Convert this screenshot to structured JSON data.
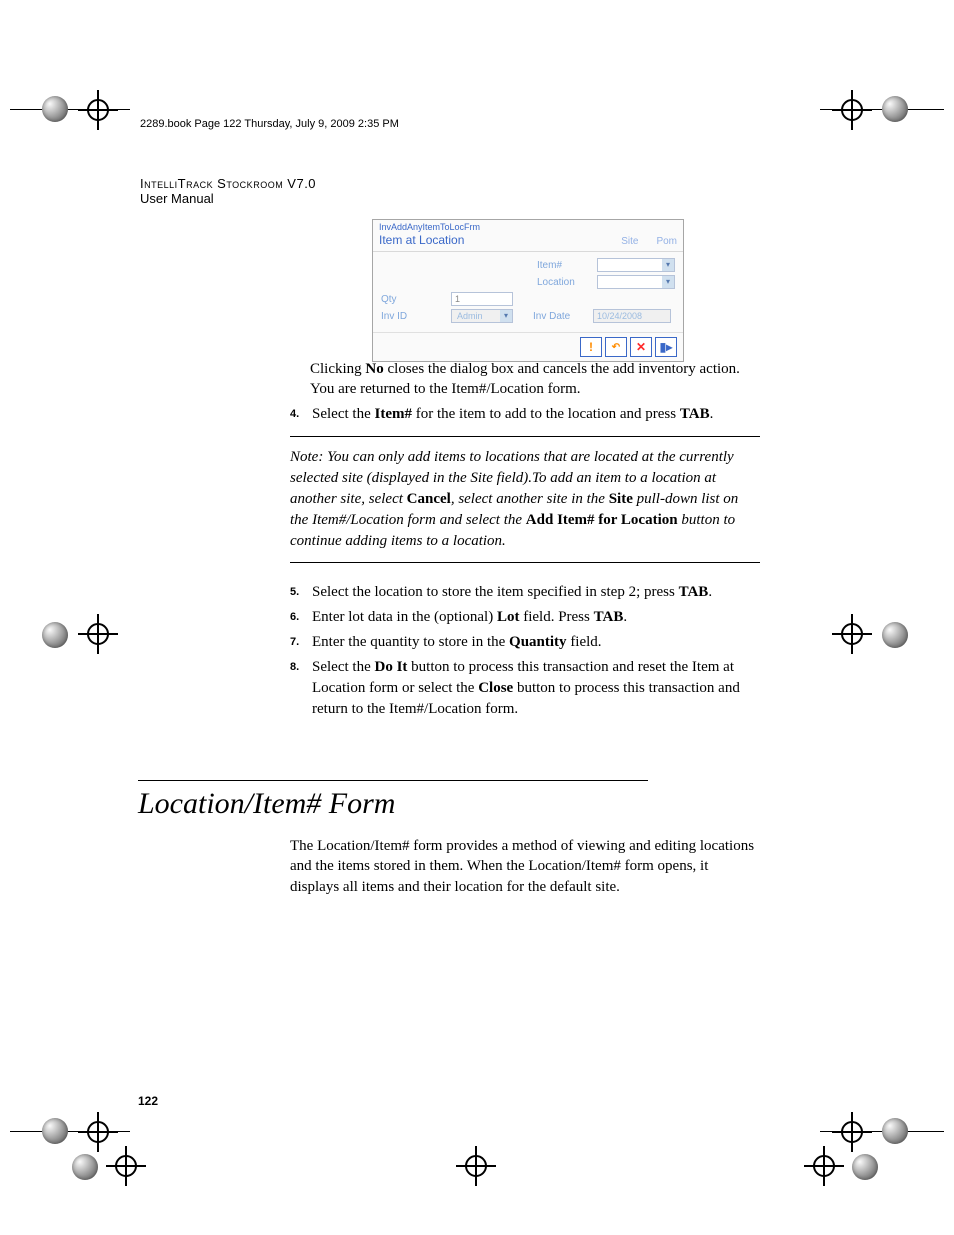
{
  "header_line": "2289.book  Page 122  Thursday, July 9, 2009  2:35 PM",
  "doc_title": "IntelliTrack Stockroom V7.0",
  "doc_subtitle": "User Manual",
  "figure": {
    "form_id": "InvAddAnyItemToLocFrm",
    "title": "Item at Location",
    "top_right_labels": {
      "site": "Site",
      "other": "Pom"
    },
    "labels": {
      "item": "Item#",
      "location": "Location",
      "qty": "Qty",
      "inv_id": "Inv ID",
      "inv_date": "Inv Date"
    },
    "values": {
      "qty": "1",
      "inv_id": "Admin",
      "inv_date": "10/24/2008"
    }
  },
  "para1_parts": {
    "p1": "Clicking ",
    "b1": "No",
    "p2": " closes the dialog box and cancels the add inventory action. You are returned to the Item#/Location form."
  },
  "steps": {
    "s4_num": "4.",
    "s4_a": "Select the ",
    "s4_b": "Item#",
    "s4_c": " for the item to add to the location and press ",
    "s4_d": "TAB",
    "s4_e": ".",
    "s5_num": "5.",
    "s5_a": "Select the location to store the item specified in step 2; press ",
    "s5_b": "TAB",
    "s5_c": ".",
    "s6_num": "6.",
    "s6_a": "Enter lot data in the (optional) ",
    "s6_b": "Lot",
    "s6_c": " field. Press ",
    "s6_d": "TAB",
    "s6_e": ".",
    "s7_num": "7.",
    "s7_a": "Enter the quantity to store in the ",
    "s7_b": "Quantity",
    "s7_c": " field.",
    "s8_num": "8.",
    "s8_a": "Select the ",
    "s8_b": "Do It",
    "s8_c": " button to process this transaction and reset the Item at Location form or select the ",
    "s8_d": "Close",
    "s8_e": " button to process this transaction and return to the Item#/Location form."
  },
  "note": {
    "n1": "Note:   You can only add items to locations that are located at the currently selected site (displayed in the Site field).To add an item to a location at another site, select ",
    "b1": "Cancel",
    "n2": ", select another site in the ",
    "b2": "Site",
    "n3": " pull-down list on the Item#/Location form and select the ",
    "b3": "Add Item# for Location",
    "n4": " button to continue adding items to a location."
  },
  "section_heading": "Location/Item# Form",
  "section_para": "The Location/Item# form provides a method of viewing and editing locations and the items stored in them. When the Location/Item# form opens, it displays all items and their location for the default site.",
  "page_number": "122"
}
